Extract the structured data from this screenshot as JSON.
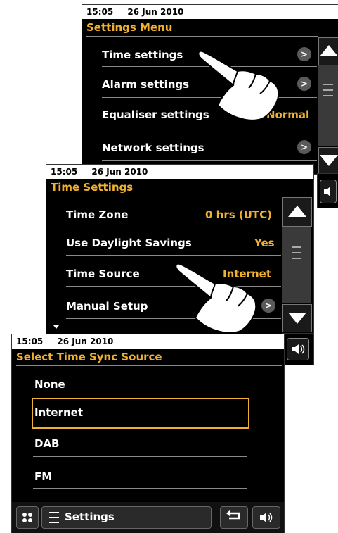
{
  "screen1": {
    "time": "15:05",
    "date": "26 Jun 2010",
    "title": "Settings Menu",
    "items": [
      {
        "label": "Time settings",
        "arrow": ">"
      },
      {
        "label": "Alarm settings",
        "arrow": ">"
      },
      {
        "label": "Equaliser settings",
        "value": "Normal"
      },
      {
        "label": "Network settings",
        "arrow": ">"
      }
    ]
  },
  "screen2": {
    "time": "15:05",
    "date": "26 Jun 2010",
    "title": "Time Settings",
    "items": [
      {
        "label": "Time Zone",
        "value": "0 hrs (UTC)"
      },
      {
        "label": "Use Daylight Savings",
        "value": "Yes"
      },
      {
        "label": "Time Source",
        "value": "Internet"
      },
      {
        "label": "Manual Setup",
        "arrow": ">"
      }
    ]
  },
  "screen3": {
    "time": "15:05",
    "date": "26 Jun 2010",
    "title": "Select Time Sync Source",
    "options": [
      "None",
      "Internet",
      "DAB",
      "FM"
    ],
    "selected": "Internet",
    "bottom_bar": {
      "settings_label": "Settings"
    }
  },
  "colors": {
    "accent": "#f0b030",
    "background": "#000000",
    "text": "#ffffff"
  }
}
